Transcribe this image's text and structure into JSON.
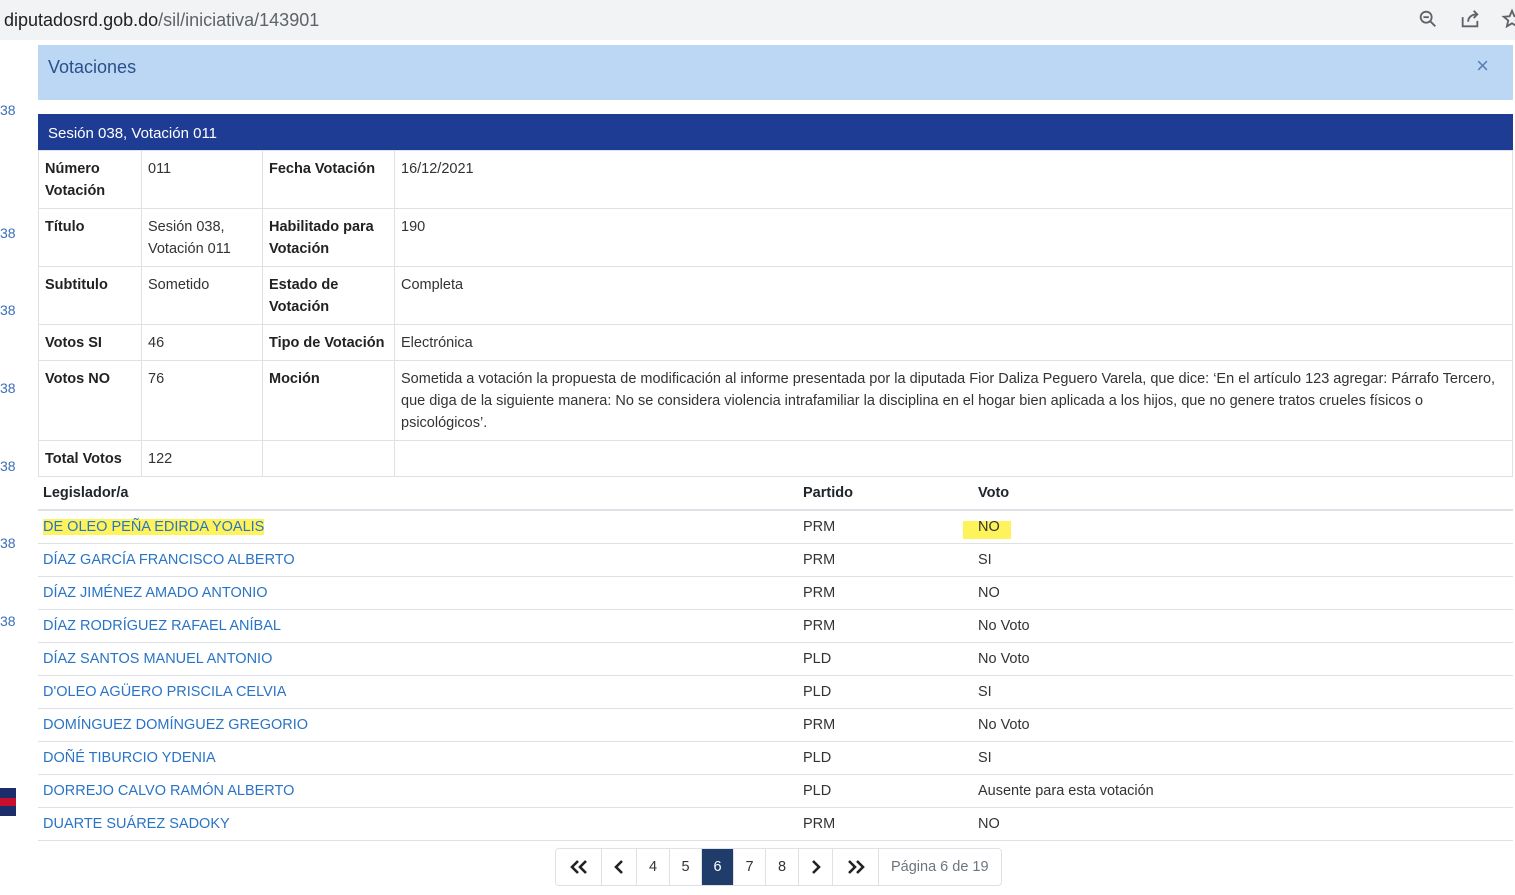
{
  "browser": {
    "url_domain": "diputadosrd.gob.do",
    "url_path": "/sil/iniciativa/143901"
  },
  "background": {
    "side_numbers": [
      "38",
      "38",
      "38",
      "38",
      "38",
      "38",
      "38"
    ]
  },
  "modal": {
    "title": "Votaciones",
    "close_label": "×"
  },
  "vote_header": "Sesión 038, Votación 011",
  "info": {
    "numero_label": "Número Votación",
    "numero": "011",
    "fecha_label": "Fecha Votación",
    "fecha": "16/12/2021",
    "titulo_label": "Título",
    "titulo": "Sesión 038, Votación 011",
    "habilitado_label": "Habilitado para Votación",
    "habilitado": "190",
    "subtitulo_label": "Subtitulo",
    "subtitulo": "Sometido",
    "estado_label": "Estado de Votación",
    "estado": "Completa",
    "si_label": "Votos SI",
    "si": "46",
    "tipo_label": "Tipo de Votación",
    "tipo": "Electrónica",
    "no_label": "Votos NO",
    "no": "76",
    "mocion_label": "Moción",
    "mocion": "Sometida a votación la propuesta de modificación al informe presentada por la diputada Fior Daliza Peguero Varela, que dice: ‘En el artículo 123 agregar: Párrafo Tercero, que diga de la siguiente manera: No se considera violencia intrafamiliar la disciplina en el hogar bien aplicada a los hijos, que no genere tratos crueles físicos o psicológicos’.",
    "total_label": "Total Votos",
    "total": "122"
  },
  "votes": {
    "headers": {
      "legislador": "Legislador/a",
      "partido": "Partido",
      "voto": "Voto"
    },
    "rows": [
      {
        "name": "DE OLEO PEÑA EDIRDA YOALIS",
        "party": "PRM",
        "vote": "NO"
      },
      {
        "name": "DÍAZ GARCÍA FRANCISCO ALBERTO",
        "party": "PRM",
        "vote": "SI"
      },
      {
        "name": "DÍAZ JIMÉNEZ AMADO ANTONIO",
        "party": "PRM",
        "vote": "NO"
      },
      {
        "name": "DÍAZ RODRÍGUEZ RAFAEL ANÍBAL",
        "party": "PRM",
        "vote": "No Voto"
      },
      {
        "name": "DÍAZ SANTOS MANUEL ANTONIO",
        "party": "PLD",
        "vote": "No Voto"
      },
      {
        "name": "D'OLEO AGÜERO PRISCILA CELVIA",
        "party": "PLD",
        "vote": "SI"
      },
      {
        "name": "DOMÍNGUEZ DOMÍNGUEZ GREGORIO",
        "party": "PRM",
        "vote": "No Voto"
      },
      {
        "name": "DOÑÉ TIBURCIO YDENIA",
        "party": "PLD",
        "vote": "SI"
      },
      {
        "name": "DORREJO CALVO RAMÓN ALBERTO",
        "party": "PLD",
        "vote": "Ausente para esta votación"
      },
      {
        "name": "DUARTE SUÁREZ SADOKY",
        "party": "PRM",
        "vote": "NO"
      }
    ]
  },
  "pager": {
    "first": "«",
    "prev": "‹",
    "pages": [
      "4",
      "5",
      "6",
      "7",
      "8"
    ],
    "active": "6",
    "next": "›",
    "last": "»",
    "info": "Página 6 de 19"
  },
  "colors": {
    "header_bar": "#1f3c95",
    "modal_head": "#bcd7f3",
    "link": "#2a74c5",
    "highlight": "#fff35c"
  }
}
